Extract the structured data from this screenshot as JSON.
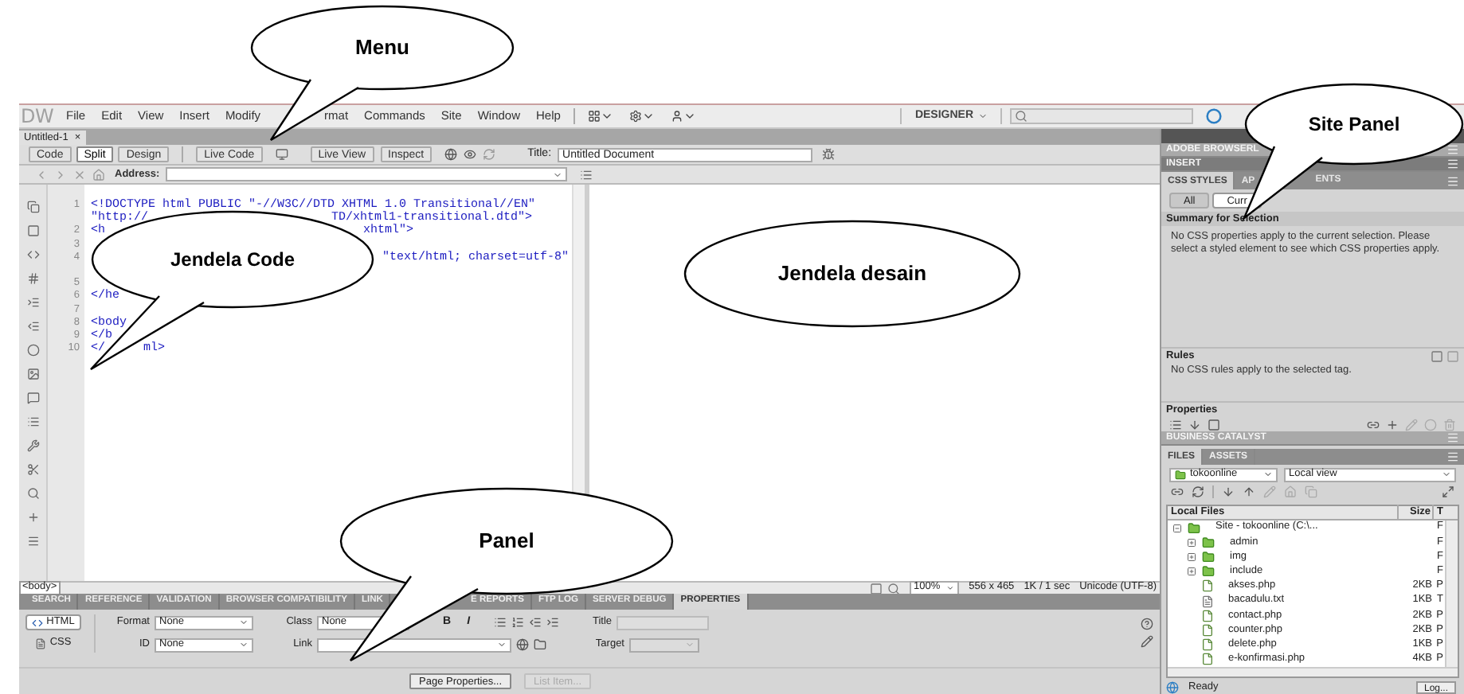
{
  "callouts": [
    {
      "text": "Menu"
    },
    {
      "text": "Site Panel"
    },
    {
      "text": "Jendela Code"
    },
    {
      "text": "Jendela desain"
    },
    {
      "text": "Panel"
    }
  ],
  "menu_bar": {
    "logo": "DW",
    "items": [
      "File",
      "Edit",
      "View",
      "Insert",
      "Modify",
      "rmat",
      "Commands",
      "Site",
      "Window",
      "Help"
    ],
    "workspace": "DESIGNER"
  },
  "document_tabs": [
    {
      "label": "Untitled-1",
      "close": "×",
      "selected": true
    }
  ],
  "toolbar": {
    "views": [
      {
        "label": "Code",
        "selected": false
      },
      {
        "label": "Split",
        "selected": true
      },
      {
        "label": "Design",
        "selected": false
      }
    ],
    "live_code": "Live Code",
    "live_view": "Live View",
    "inspect": "Inspect",
    "title_label": "Title:",
    "title_value": "Untitled Document"
  },
  "address_bar": {
    "label": "Address:"
  },
  "code_view": {
    "rows": [
      {
        "number": "1",
        "segments": [
          "<!DOCTYPE html PUBLIC \"-//W3C//DTD XHTML 1.0 Transitional//EN\""
        ]
      },
      {
        "segments": [
          "\"http://",
          "TD/xhtml1-transitional.dtd\">"
        ]
      },
      {
        "number": "2",
        "segments": [
          "<h",
          "xhtml\">"
        ]
      },
      {
        "number": "3"
      },
      {
        "number": "4",
        "segments": [
          "\"text/html; charset=utf-8\""
        ]
      },
      {
        "number": "5"
      },
      {
        "number": "6",
        "segments": [
          "</he"
        ]
      },
      {
        "number": "7"
      },
      {
        "number": "8",
        "segments": [
          "<body"
        ]
      },
      {
        "number": "9",
        "segments": [
          "</b"
        ]
      },
      {
        "number": "10",
        "segments": [
          "</",
          "ml>"
        ]
      }
    ]
  },
  "status_bar": {
    "tag": "<body>",
    "zoom": "100%",
    "size": "556 x 465",
    "download": "1K / 1 sec",
    "encoding": "Unicode (UTF-8)"
  },
  "panel_tabs": [
    {
      "label": "SEARCH",
      "selected": false
    },
    {
      "label": "REFERENCE",
      "selected": false
    },
    {
      "label": "VALIDATION",
      "selected": false
    },
    {
      "label": "BROWSER COMPATIBILITY",
      "selected": false
    },
    {
      "label": "LINK",
      "selected": false
    },
    {
      "label": "E REPORTS",
      "selected": false
    },
    {
      "label": "FTP LOG",
      "selected": false
    },
    {
      "label": "SERVER DEBUG",
      "selected": false
    },
    {
      "label": "PROPERTIES",
      "selected": true
    }
  ],
  "properties": {
    "modes": [
      {
        "label": "HTML",
        "selected": true
      },
      {
        "label": "CSS",
        "selected": false
      }
    ],
    "format_label": "Format",
    "format_value": "None",
    "id_label": "ID",
    "id_value": "None",
    "class_label": "Class",
    "class_value": "None",
    "link_label": "Link",
    "bold": "B",
    "italic": "I",
    "title_label": "Title",
    "target_label": "Target",
    "buttons": [
      {
        "label": "Page Properties...",
        "disabled": false
      },
      {
        "label": "List Item...",
        "disabled": true
      }
    ]
  },
  "right_panel": {
    "browserlab": "ADOBE BROWSERL",
    "insert": "INSERT",
    "css_tabs": [
      {
        "label": "CSS STYLES",
        "selected": true
      },
      {
        "label": "AP",
        "label_end": "ENTS",
        "selected": false
      }
    ],
    "css_modes": [
      {
        "label": "All",
        "selected": false
      },
      {
        "label": "Curr",
        "selected": true
      }
    ],
    "summary_title": "Summary for Selection",
    "summary_text": "No CSS properties apply to the current selection.  Please select a styled element to see which CSS properties apply.",
    "rules_title": "Rules",
    "rules_text": "No CSS rules apply to the selected tag.",
    "properties_title": "Properties",
    "business_catalyst": "BUSINESS CATALYST",
    "files_tabs": [
      {
        "label": "FILES",
        "selected": true
      },
      {
        "label": "ASSETS",
        "selected": false
      }
    ],
    "site_select": "tokoonline",
    "view_select": "Local view",
    "files_columns": [
      "Local Files",
      "Size",
      "T"
    ],
    "tree": [
      {
        "name": "Site - tokoonline (C:\\...",
        "kind": "site",
        "expanded": true,
        "type": "F",
        "children": [
          {
            "name": "admin",
            "kind": "folder",
            "expanded": false,
            "type": "F"
          },
          {
            "name": "img",
            "kind": "folder",
            "expanded": false,
            "type": "F"
          },
          {
            "name": "include",
            "kind": "folder",
            "expanded": false,
            "type": "F"
          },
          {
            "name": "akses.php",
            "kind": "file",
            "size": "2KB",
            "type": "P"
          },
          {
            "name": "bacadulu.txt",
            "kind": "text",
            "size": "1KB",
            "type": "T"
          },
          {
            "name": "contact.php",
            "kind": "file",
            "size": "2KB",
            "type": "P"
          },
          {
            "name": "counter.php",
            "kind": "file",
            "size": "2KB",
            "type": "P"
          },
          {
            "name": "delete.php",
            "kind": "file",
            "size": "1KB",
            "type": "P"
          },
          {
            "name": "e-konfirmasi.php",
            "kind": "file",
            "size": "4KB",
            "type": "P"
          }
        ]
      }
    ],
    "status": "Ready",
    "log_button": "Log..."
  }
}
